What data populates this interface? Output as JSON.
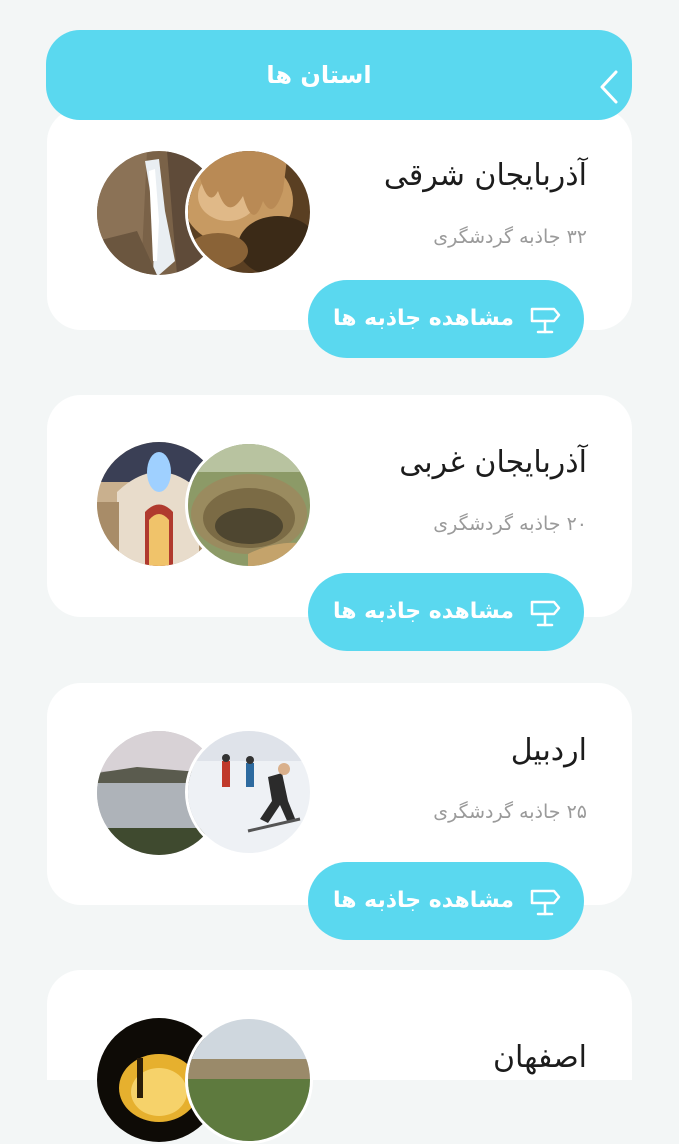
{
  "header": {
    "title": "استان ها"
  },
  "provinces": [
    {
      "name": "آذربایجان شرقی",
      "attractions": "۳۲ جاذبه گردشگری",
      "button_label": "مشاهده جاذبه ها"
    },
    {
      "name": "آذربایجان غربی",
      "attractions": "۲۰ جاذبه گردشگری",
      "button_label": "مشاهده جاذبه ها"
    },
    {
      "name": "اردبیل",
      "attractions": "۲۵ جاذبه گردشگری",
      "button_label": "مشاهده جاذبه ها"
    },
    {
      "name": "اصفهان",
      "attractions": "",
      "button_label": ""
    }
  ],
  "icons": {
    "back": "chevron-left-icon",
    "signpost": "signpost-icon"
  },
  "colors": {
    "accent": "#5ad8ef",
    "background": "#f3f6f6",
    "card": "#ffffff"
  }
}
